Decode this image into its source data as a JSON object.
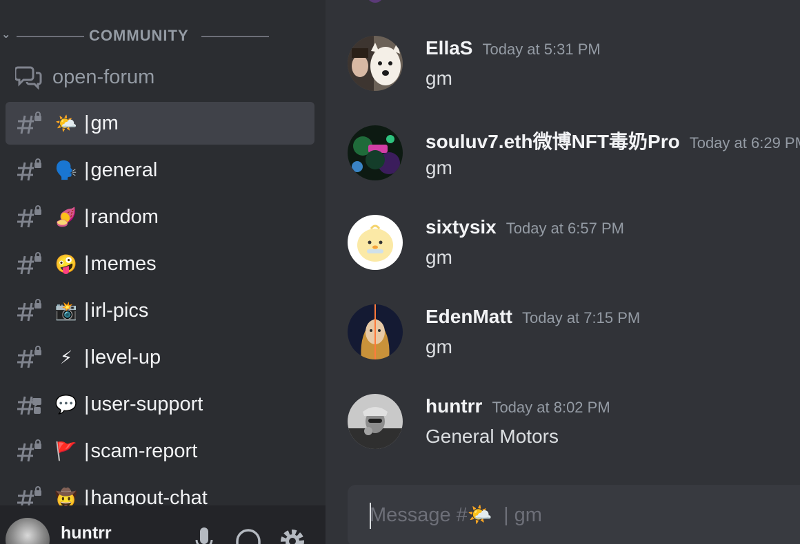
{
  "sidebar": {
    "category": {
      "label": "COMMUNITY"
    },
    "forum": {
      "label": "open-forum",
      "icon": "forum-icon"
    },
    "channels": [
      {
        "emoji": "🌤️",
        "label": "gm",
        "active": true,
        "icon": "locked-hash-icon"
      },
      {
        "emoji": "🗣️",
        "label": "general",
        "icon": "locked-hash-icon"
      },
      {
        "emoji": "🍠",
        "label": "random",
        "icon": "locked-hash-icon"
      },
      {
        "emoji": "🤪",
        "label": "memes",
        "icon": "locked-hash-icon"
      },
      {
        "emoji": "📸",
        "label": "irl-pics",
        "icon": "locked-hash-icon"
      },
      {
        "emoji": "⚡",
        "label": "level-up",
        "icon": "locked-hash-icon"
      },
      {
        "emoji": "💬",
        "label": "user-support",
        "icon": "thread-hash-icon"
      },
      {
        "emoji": "🚩",
        "label": "scam-report",
        "icon": "locked-hash-icon"
      },
      {
        "emoji": "🤠",
        "label": "hangout-chat",
        "icon": "locked-hash-icon"
      }
    ],
    "channel_bar": "|"
  },
  "user_panel": {
    "username": "huntrr",
    "controls": [
      "microphone-icon",
      "headphones-icon",
      "gear-icon"
    ]
  },
  "messages": [
    {
      "author": "EllaS",
      "time": "Today at 5:31 PM",
      "text": "gm",
      "avatar": "avatar-ellas"
    },
    {
      "author": "souluv7.eth微博NFT毒奶Pro",
      "time": "Today at 6:29 PM",
      "text": "gm",
      "avatar": "avatar-souluv7"
    },
    {
      "author": "sixtysix",
      "time": "Today at 6:57 PM",
      "text": "gm",
      "avatar": "avatar-sixtysix"
    },
    {
      "author": "EdenMatt",
      "time": "Today at 7:15 PM",
      "text": "gm",
      "avatar": "avatar-edenmatt"
    },
    {
      "author": "huntrr",
      "time": "Today at 8:02 PM",
      "text": "General Motors",
      "avatar": "avatar-huntrr"
    }
  ],
  "composer": {
    "placeholder": "Message #🌤️  | gm",
    "value": ""
  },
  "colors": {
    "sidebar_bg": "#2b2d31",
    "chat_bg": "#313338",
    "active_channel": "#404249",
    "composer_bg": "#383a40",
    "muted_text": "#949ba4"
  }
}
